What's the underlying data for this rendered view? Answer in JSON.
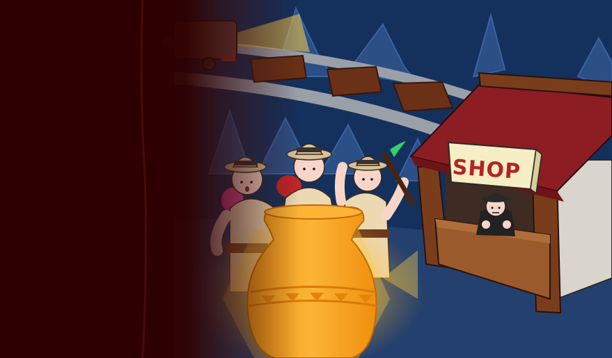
{
  "scene": {
    "name": "mine-cave-shop",
    "shop_sign": "SHOP"
  },
  "colors": {
    "cave_bg": "#14305c",
    "cave_floor": "#24406e",
    "rock": "#2c4f86",
    "rail": "#9aa0aa",
    "tie": "#6a3117",
    "roof": "#8c1d22",
    "shop_wall": "#d9d4cc",
    "wood": "#7a3d1c",
    "sign_bg": "#f6eec4",
    "sign_text": "#b52324",
    "pot": "#f7a41d",
    "explorer_shirt": "#ecd9b3",
    "explorer_skin": "#f7d6c9",
    "left_shadow": "#3a0000"
  },
  "characters": [
    {
      "id": "explorer-left",
      "accessory": "pink-backpack"
    },
    {
      "id": "explorer-center",
      "accessory": "red-backpack"
    },
    {
      "id": "explorer-right",
      "accessory": "pickaxe"
    },
    {
      "id": "shopkeeper",
      "accessory": "bowler-hat"
    }
  ]
}
